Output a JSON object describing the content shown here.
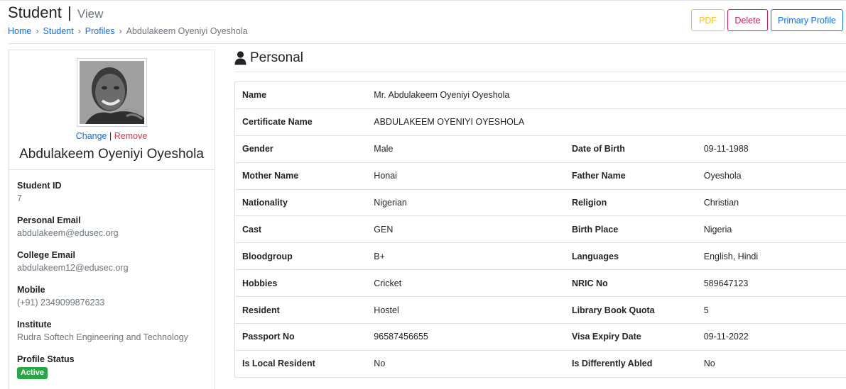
{
  "page": {
    "title": "Student",
    "separator": "|",
    "subtitle": "View"
  },
  "breadcrumb": {
    "home": "Home",
    "student": "Student",
    "profiles": "Profiles",
    "current": "Abdulakeem Oyeniyi Oyeshola",
    "separator": "›"
  },
  "actions": {
    "pdf": "PDF",
    "delete": "Delete",
    "primary_profile": "Primary Profile"
  },
  "profile": {
    "change": "Change",
    "divider": "|",
    "remove": "Remove",
    "name": "Abdulakeem Oyeniyi Oyeshola",
    "fields": [
      {
        "label": "Student ID",
        "value": "7"
      },
      {
        "label": "Personal Email",
        "value": "abdulakeem@edusec.org"
      },
      {
        "label": "College Email",
        "value": "abdulakeem12@edusec.org"
      },
      {
        "label": "Mobile",
        "value": "(+91) 2349099876233"
      },
      {
        "label": "Institute",
        "value": "Rudra Softech Engineering and Technology"
      }
    ],
    "status_label": "Profile Status",
    "status_value": "Active"
  },
  "section": {
    "icon": "user-icon",
    "title": "Personal"
  },
  "details": {
    "rows": [
      {
        "l1": "Name",
        "v1": "Mr. Abdulakeem Oyeniyi Oyeshola",
        "l2": "",
        "v2": ""
      },
      {
        "l1": "Certificate Name",
        "v1": "ABDULAKEEM OYENIYI OYESHOLA",
        "l2": "",
        "v2": ""
      },
      {
        "l1": "Gender",
        "v1": "Male",
        "l2": "Date of Birth",
        "v2": "09-11-1988"
      },
      {
        "l1": "Mother Name",
        "v1": "Honai",
        "l2": "Father Name",
        "v2": "Oyeshola"
      },
      {
        "l1": "Nationality",
        "v1": "Nigerian",
        "l2": "Religion",
        "v2": "Christian"
      },
      {
        "l1": "Cast",
        "v1": "GEN",
        "l2": "Birth Place",
        "v2": "Nigeria"
      },
      {
        "l1": "Bloodgroup",
        "v1": "B+",
        "l2": "Languages",
        "v2": "English, Hindi"
      },
      {
        "l1": "Hobbies",
        "v1": "Cricket",
        "l2": "NRIC No",
        "v2": "589647123"
      },
      {
        "l1": "Resident",
        "v1": "Hostel",
        "l2": "Library Book Quota",
        "v2": "5"
      },
      {
        "l1": "Passport No",
        "v1": "96587456655",
        "l2": "Visa Expiry Date",
        "v2": "09-11-2022"
      },
      {
        "l1": "Is Local Resident",
        "v1": "No",
        "l2": "Is Differently Abled",
        "v2": "No"
      }
    ]
  },
  "colors": {
    "primary": "#0d6efd",
    "warning": "#ffc107",
    "danger": "#d81b60",
    "success": "#28a745",
    "muted": "#6c757d",
    "border": "#dee2e6"
  }
}
